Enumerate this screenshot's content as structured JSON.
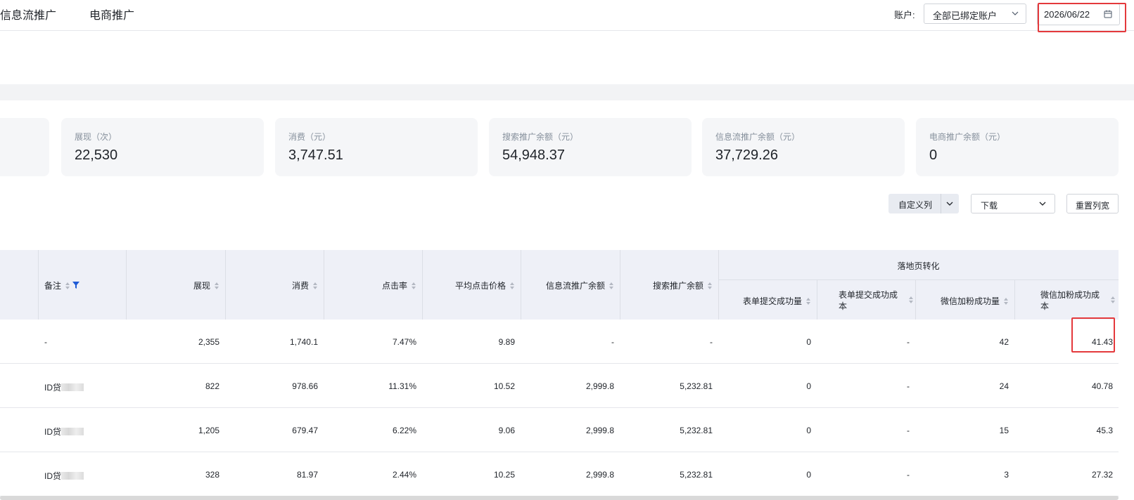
{
  "header": {
    "tabs": [
      "信息流推广",
      "电商推广"
    ],
    "account_label": "账户:",
    "account_value": "全部已绑定账户",
    "date_value": "2026/06/22"
  },
  "cards": [
    {
      "label": "展现（次）",
      "value": "22,530"
    },
    {
      "label": "消费（元）",
      "value": "3,747.51"
    },
    {
      "label": "搜索推广余额（元）",
      "value": "54,948.37"
    },
    {
      "label": "信息流推广余额（元）",
      "value": "37,729.26"
    },
    {
      "label": "电商推广余额（元）",
      "value": "0"
    }
  ],
  "toolbar": {
    "custom_columns": "自定义列",
    "download": "下载",
    "reset_width": "重置列宽"
  },
  "table": {
    "group_header": "落地页转化",
    "columns": {
      "note": "备注",
      "impressions": "展现",
      "cost": "消费",
      "ctr": "点击率",
      "avg_cpc": "平均点击价格",
      "feed_balance": "信息流推广余额",
      "search_balance": "搜索推广余额",
      "form_submits": "表单提交成功量",
      "form_cost_l1": "表单提交成功成",
      "form_cost_l2": "本",
      "wechat_fans": "微信加粉成功量",
      "wechat_cost_l1": "微信加粉成功成",
      "wechat_cost_l2": "本"
    },
    "rows": [
      {
        "note": "-",
        "masked": false,
        "impressions": "2,355",
        "cost": "1,740.1",
        "ctr": "7.47%",
        "avg_cpc": "9.89",
        "feed_balance": "-",
        "search_balance": "-",
        "form_submits": "0",
        "form_cost": "-",
        "wechat_fans": "42",
        "wechat_cost": "41.43"
      },
      {
        "note": "ID贷",
        "masked": true,
        "impressions": "822",
        "cost": "978.66",
        "ctr": "11.31%",
        "avg_cpc": "10.52",
        "feed_balance": "2,999.8",
        "search_balance": "5,232.81",
        "form_submits": "0",
        "form_cost": "-",
        "wechat_fans": "24",
        "wechat_cost": "40.78"
      },
      {
        "note": "ID贷",
        "masked": true,
        "impressions": "1,205",
        "cost": "679.47",
        "ctr": "6.22%",
        "avg_cpc": "9.06",
        "feed_balance": "2,999.8",
        "search_balance": "5,232.81",
        "form_submits": "0",
        "form_cost": "-",
        "wechat_fans": "15",
        "wechat_cost": "45.3"
      },
      {
        "note": "ID贷",
        "masked": true,
        "impressions": "328",
        "cost": "81.97",
        "ctr": "2.44%",
        "avg_cpc": "10.25",
        "feed_balance": "2,999.8",
        "search_balance": "5,232.81",
        "form_submits": "0",
        "form_cost": "-",
        "wechat_fans": "3",
        "wechat_cost": "27.32"
      }
    ]
  },
  "colors": {
    "accent_blue": "#1f5bd6",
    "highlight_red": "#e4393c",
    "header_bg": "#eef0f7",
    "card_bg": "#f5f6f8"
  }
}
